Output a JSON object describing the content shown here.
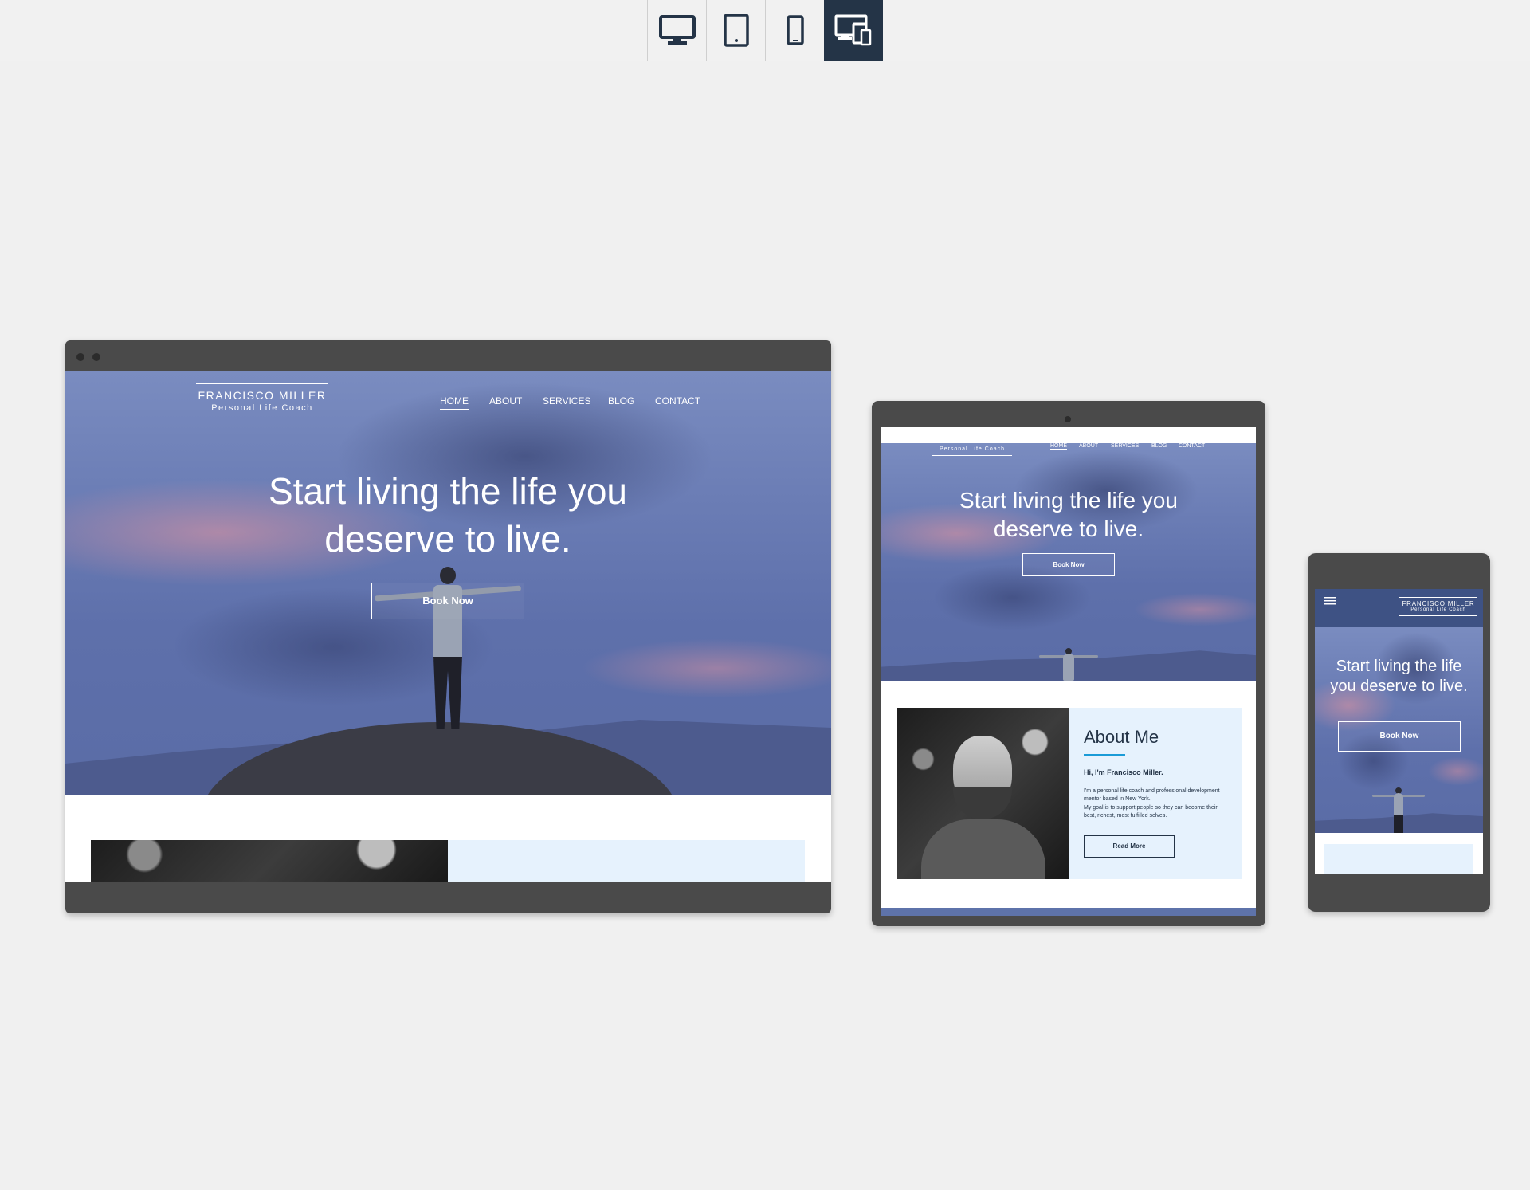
{
  "toolbar": {
    "buttons": [
      {
        "name": "desktop-view",
        "icon": "monitor-icon",
        "active": false
      },
      {
        "name": "tablet-view",
        "icon": "tablet-icon",
        "active": false
      },
      {
        "name": "mobile-view",
        "icon": "phone-icon",
        "active": false
      },
      {
        "name": "all-devices-view",
        "icon": "devices-icon",
        "active": true
      }
    ],
    "active_color": "#243447"
  },
  "site": {
    "logo_name": "FRANCISCO MILLER",
    "logo_tagline": "Personal Life Coach",
    "nav": [
      "HOME",
      "ABOUT",
      "SERVICES",
      "BLOG",
      "CONTACT"
    ],
    "hero_title": "Start living the life you deserve to live.",
    "hero_button": "Book Now",
    "about_heading": "About Me",
    "about_greeting": "Hi, I'm Francisco Miller.",
    "about_text_1": "I'm a personal life coach and professional development mentor based in New York.",
    "about_text_2": "My goal is to support people so they can become their best, richest, most fulfilled selves.",
    "read_more": "Read More",
    "accent_color": "#1a9bd7",
    "card_color": "#e6f2fd",
    "header_color_mobile": "#3e5284"
  }
}
